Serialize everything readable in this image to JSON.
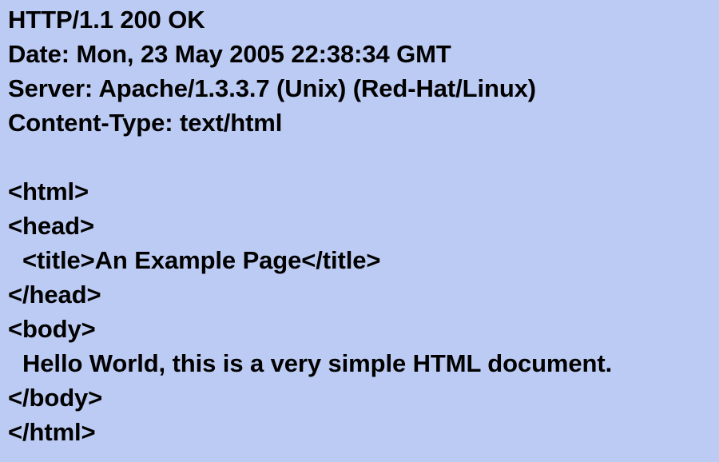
{
  "headers": {
    "status_line": "HTTP/1.1 200 OK",
    "date": "Date: Mon, 23 May 2005 22:38:34 GMT",
    "server": "Server: Apache/1.3.3.7 (Unix) (Red-Hat/Linux)",
    "content_type": "Content-Type: text/html"
  },
  "body_lines": {
    "html_open": "<html>",
    "head_open": "<head>",
    "title": "<title>An Example Page</title>",
    "head_close": "</head>",
    "body_open": "<body>",
    "body_text": "Hello World, this is a very simple HTML document.",
    "body_close": "</body>",
    "html_close": "</html>"
  }
}
